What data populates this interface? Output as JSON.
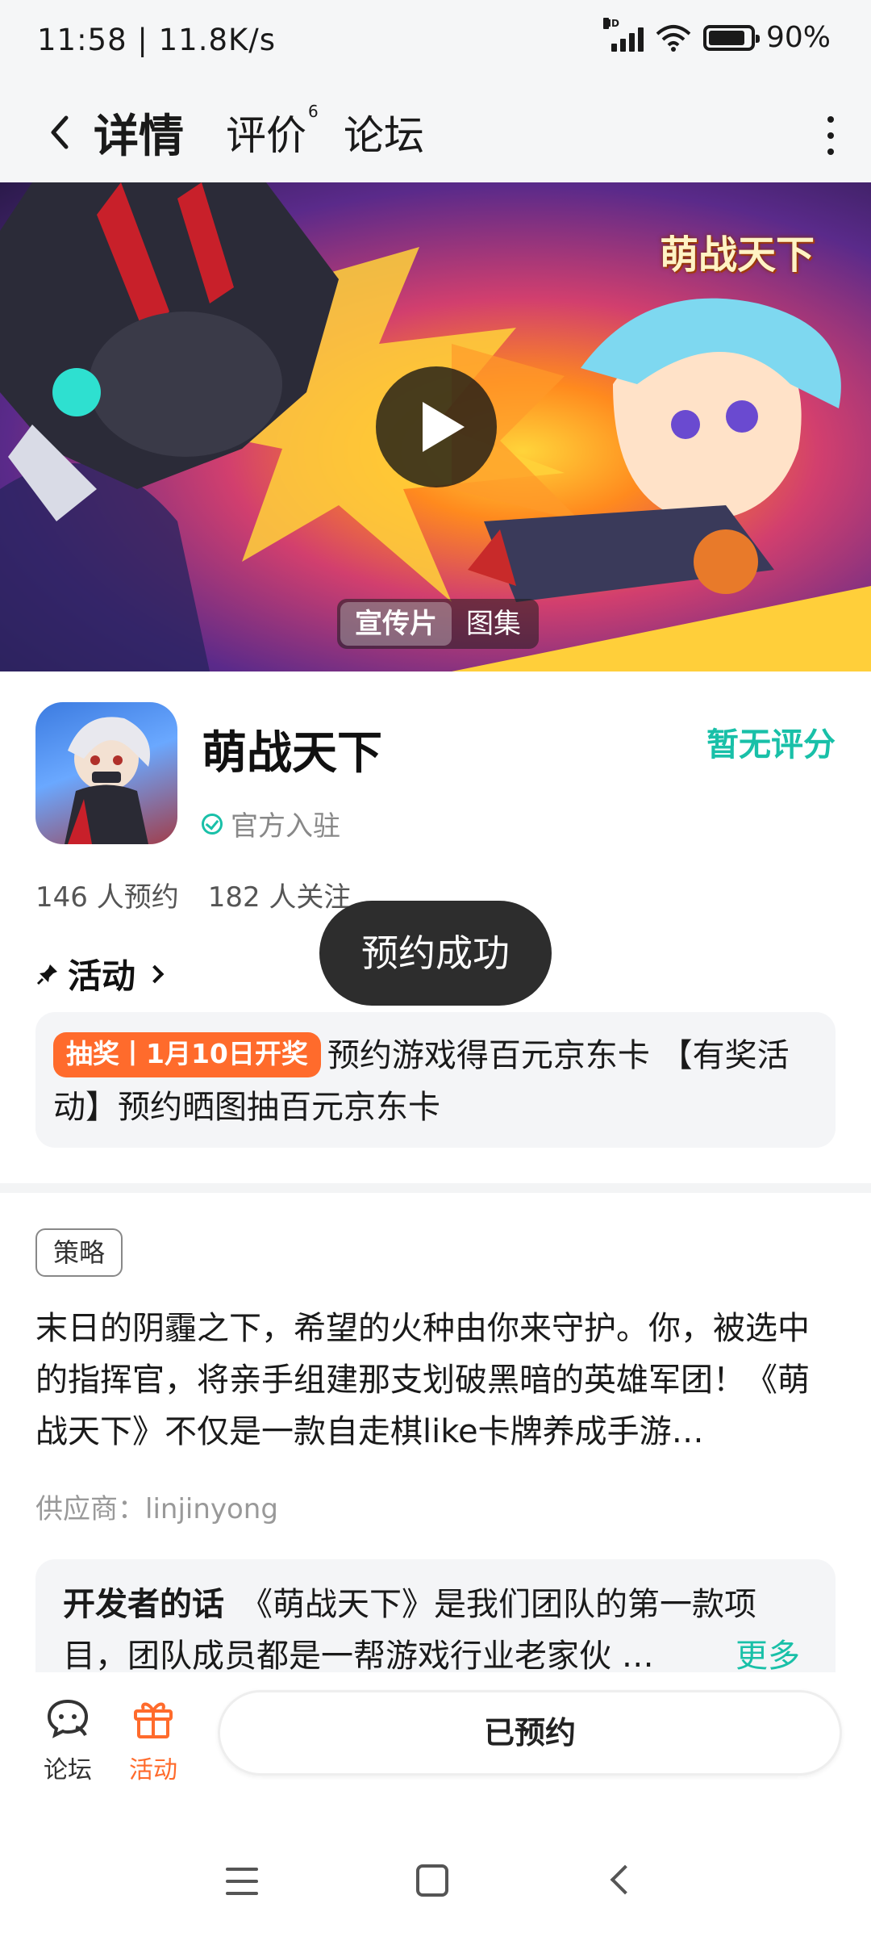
{
  "status_bar": {
    "time_speed": "11:58 | 11.8K/s",
    "network_badge": "HD",
    "battery": "90%"
  },
  "nav": {
    "tabs": [
      {
        "label": "详情"
      },
      {
        "label": "评价",
        "count": "6"
      },
      {
        "label": "论坛"
      }
    ],
    "back_icon": "chevron-left-icon",
    "more_icon": "more-vertical-icon"
  },
  "banner": {
    "logo_text": "萌战天下",
    "media_tabs": [
      "宣传片",
      "图集"
    ]
  },
  "app": {
    "name": "萌战天下",
    "official": "官方入驻",
    "rating": "暂无评分",
    "reservations": "146 人预约",
    "followers": "182 人关注"
  },
  "activity": {
    "heading": "活动",
    "badge": "抽奖丨1月10日开奖",
    "text": "预约游戏得百元京东卡 【有奖活动】预约晒图抽百元京东卡"
  },
  "strategy": {
    "tag": "策略",
    "description": "末日的阴霾之下，希望的火种由你来守护。你，被选中的指挥官，将亲手组建那支划破黑暗的英雄军团！《萌战天下》不仅是一款自走棋like卡牌养成手游…",
    "supplier": "供应商：linjinyong"
  },
  "developer": {
    "label": "开发者的话",
    "text": "《萌战天下》是我们团队的第一款项目，团队成员都是一帮游戏行业老家伙 …",
    "more": "更多"
  },
  "bottom": {
    "forum": "论坛",
    "activity": "活动",
    "reserved": "已预约"
  },
  "toast": "预约成功",
  "colors": {
    "accent": "#19c0a8",
    "orange": "#ff6b2c"
  }
}
